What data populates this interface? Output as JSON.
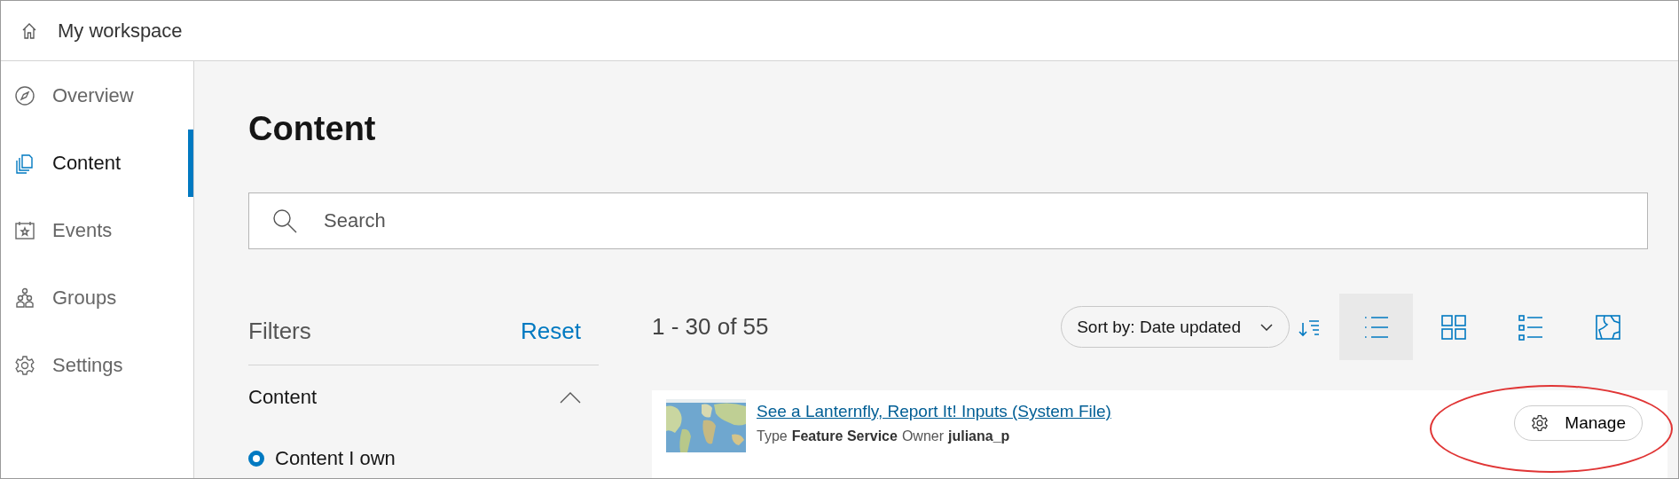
{
  "header": {
    "title": "My workspace"
  },
  "sidebar": {
    "items": [
      {
        "label": "Overview",
        "kind": "compass",
        "selected": false
      },
      {
        "label": "Content",
        "kind": "pages",
        "selected": true
      },
      {
        "label": "Events",
        "kind": "calendar",
        "selected": false
      },
      {
        "label": "Groups",
        "kind": "people",
        "selected": false
      },
      {
        "label": "Settings",
        "kind": "gear",
        "selected": false
      }
    ]
  },
  "page_title": "Content",
  "search": {
    "placeholder": "Search"
  },
  "filters": {
    "title": "Filters",
    "reset": "Reset",
    "section": {
      "label": "Content",
      "expanded": true
    },
    "options": [
      {
        "label": "Content I own",
        "selected": true
      }
    ]
  },
  "results": {
    "count": "1 - 30 of 55",
    "sort": "Sort by: Date updated",
    "views": [
      {
        "kind": "list",
        "selected": true
      },
      {
        "kind": "grid",
        "selected": false
      },
      {
        "kind": "table",
        "selected": false
      },
      {
        "kind": "map",
        "selected": false
      }
    ],
    "items": [
      {
        "title": "See a Lanternfly, Report It! Inputs (System File)",
        "type_label": "Type",
        "type": "Feature Service",
        "owner_label": "Owner",
        "owner": "juliana_p",
        "action": "Manage",
        "highlighted": true
      }
    ]
  }
}
